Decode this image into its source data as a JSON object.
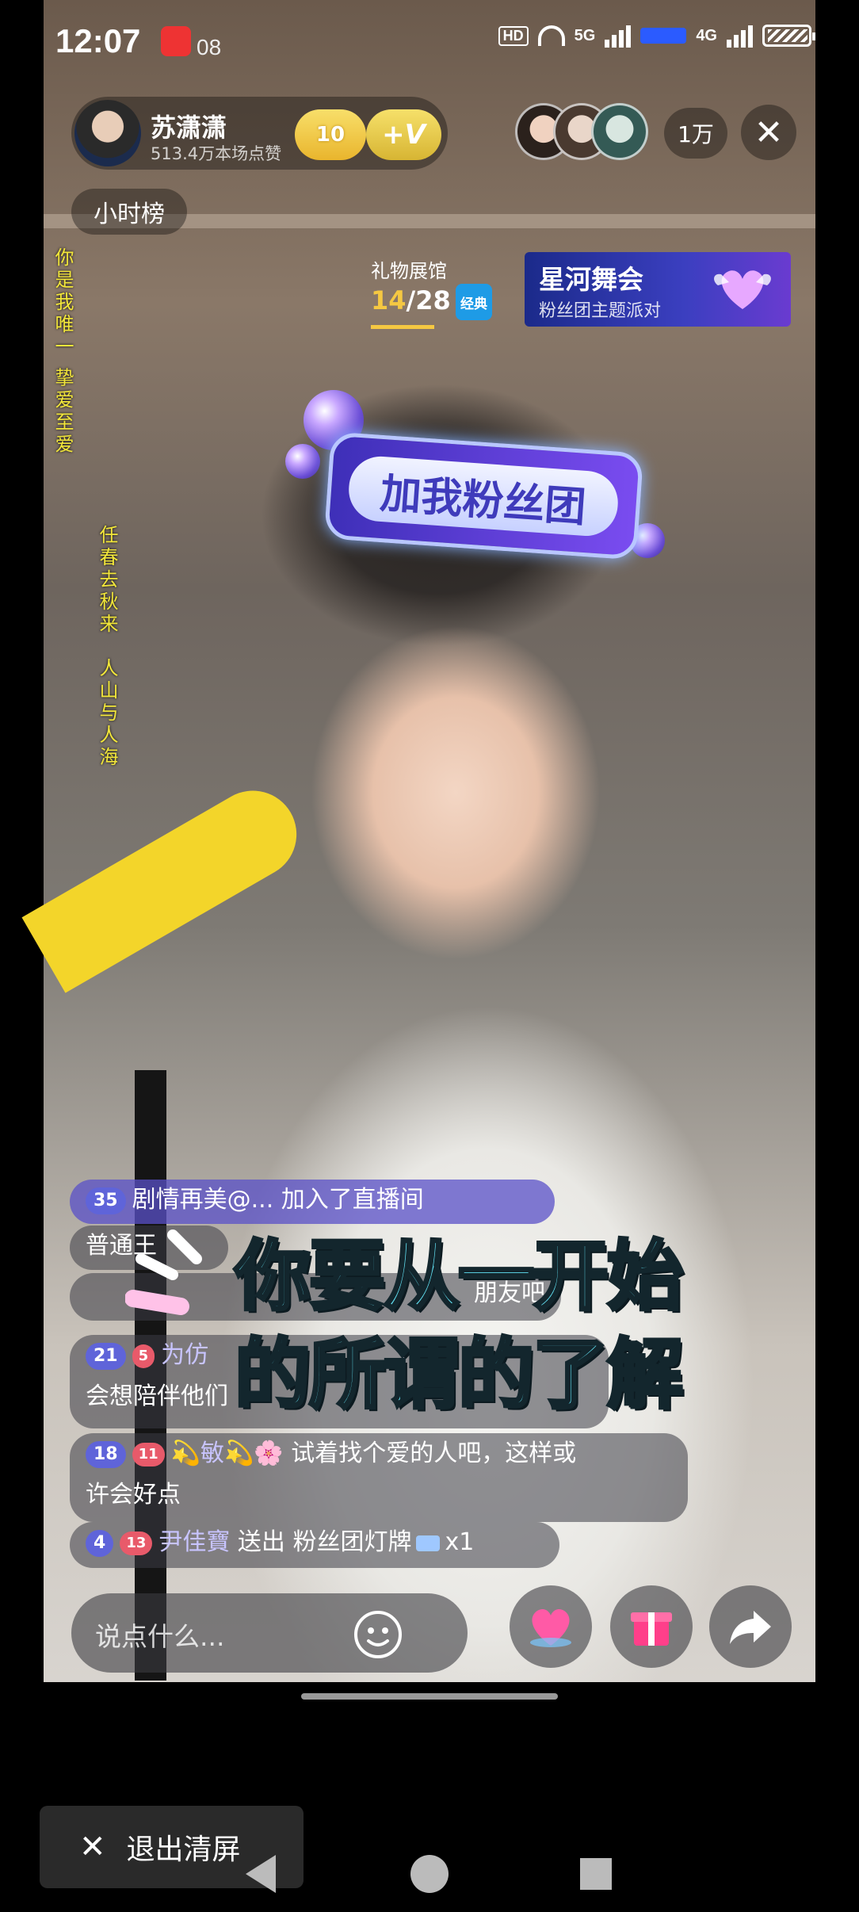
{
  "status_bar": {
    "time": "12:07",
    "notification_count": "08",
    "hd_label": "HD",
    "net_5g": "5G",
    "net_4g": "4G",
    "icons": [
      "notification-icon",
      "wifi-icon",
      "signal-icon",
      "battery-icon"
    ]
  },
  "host": {
    "name": "苏潇潇",
    "stats": "513.4万本场点赞",
    "level": "10",
    "fan_badge": "+V"
  },
  "viewers": {
    "count": "1万"
  },
  "close_label": "✕",
  "rank_label": "小时榜",
  "lyrics_left": "你是我唯一 挚爱至爱",
  "lyrics_right_1": "任春去秋来",
  "lyrics_right_2": "人山与人海",
  "gift_hall": {
    "label": "礼物展馆",
    "current": "14",
    "total": "/28",
    "tag": "经典"
  },
  "event_banner": {
    "title": "星河舞会",
    "subtitle": "粉丝团主题派对"
  },
  "fan_sticker": "加我粉丝团",
  "chat": {
    "join": {
      "level": "35",
      "name": "剧情再美@...",
      "text": "加入了直播间"
    },
    "row2_prefix": "普通王",
    "row3_text": "朋友吧",
    "row4": {
      "level": "21",
      "fan": "5",
      "name": "为仿"
    },
    "row4_line2": "会想陪伴他们",
    "row5": {
      "level": "18",
      "fan": "11",
      "name": "💫敏💫🌸",
      "text": "试着找个爱的人吧，这样或"
    },
    "row5_line2": "许会好点",
    "gift": {
      "level": "4",
      "fan": "13",
      "name": "尹佳寶",
      "action": "送出",
      "item": "粉丝团灯牌",
      "qty": "x1"
    }
  },
  "subtitle_line1": "你要从一开始",
  "subtitle_line2": "的所谓的了解",
  "input": {
    "placeholder": "说点什么..."
  },
  "exit_clean": "退出清屏",
  "colors": {
    "subtitle": "#63e3f5",
    "gold": "#f5c842",
    "lyrics": "#f2e63a",
    "event": "#3b3fc0"
  }
}
